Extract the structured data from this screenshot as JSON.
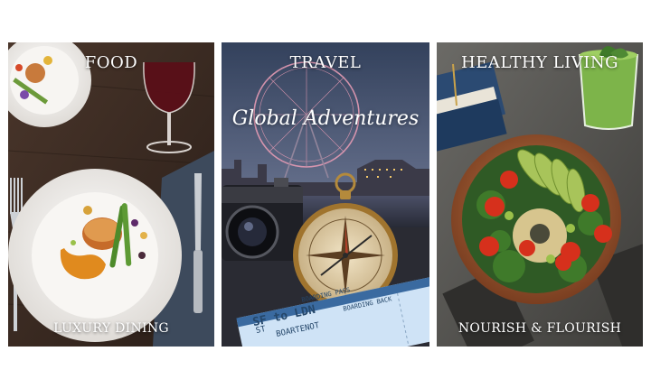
{
  "panels": {
    "food": {
      "title": "FOOD",
      "subtitle": "LUXURY DINING",
      "colors": {
        "bg": "#3b2a22",
        "plate": "#f3f1ee",
        "sauce": "#e08a1e"
      },
      "icons": [
        "plate-icon",
        "wine-glass-icon",
        "fork-icon",
        "knife-icon"
      ]
    },
    "travel": {
      "title": "TRAVEL",
      "script_text": "Global Adventures",
      "ticket": {
        "header": "BOARDING PASS",
        "route": "SF to LDN",
        "seat": "ST",
        "extra": "BOARDING BACK",
        "code": "BOARTENOT"
      },
      "colors": {
        "sky": "#4a5a78",
        "ticket": "#cfe3f6"
      },
      "icons": [
        "ferris-wheel-icon",
        "camera-icon",
        "compass-icon",
        "ticket-icon"
      ]
    },
    "health": {
      "title": "HEALTHY LIVING",
      "subtitle": "NOURISH & FLOURISH",
      "colors": {
        "bowl": "#a6603a",
        "kale": "#2f5a25",
        "tomato": "#d6301c",
        "avocado": "#a8c45a"
      },
      "icons": [
        "salad-bowl-icon",
        "smoothie-glass-icon",
        "books-icon"
      ]
    }
  }
}
